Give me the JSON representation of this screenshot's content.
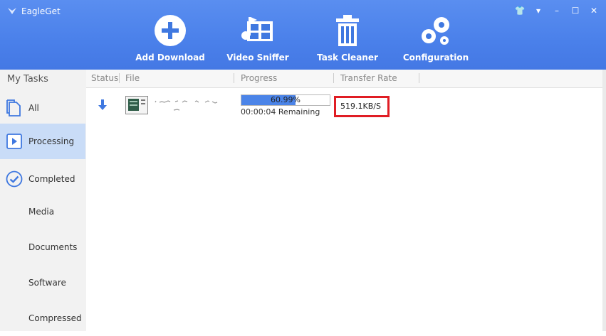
{
  "app": {
    "title": "EagleGet"
  },
  "toolbar": {
    "add_download": "Add Download",
    "video_sniffer": "Video Sniffer",
    "task_cleaner": "Task Cleaner",
    "configuration": "Configuration"
  },
  "sidebar": {
    "heading": "My Tasks",
    "items": [
      "All",
      "Processing",
      "Completed",
      "Media",
      "Documents",
      "Software",
      "Compressed"
    ]
  },
  "columns": {
    "status": "Status",
    "file": "File",
    "progress": "Progress",
    "rate": "Transfer Rate"
  },
  "task": {
    "progress_percent": 60.99,
    "progress_label": "60.99%",
    "remaining": "00:00:04 Remaining",
    "rate": "519.1KB/S"
  },
  "colors": {
    "toolbar": "#4a80ea",
    "progress_fill": "#4b84e8",
    "highlight": "#e01d24",
    "active_sidebar": "#c9dcf7"
  }
}
